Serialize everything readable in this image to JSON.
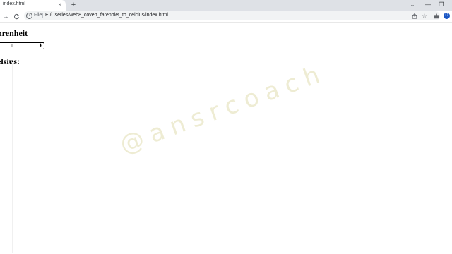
{
  "browser": {
    "tab_title": "index.html",
    "tab_close": "×",
    "new_tab": "+",
    "window_controls": {
      "minimize": "—",
      "maximize": "❐",
      "dropdown": "⌄"
    },
    "nav": {
      "forward": "→",
      "reload": "C"
    },
    "address": {
      "scheme_label": "File",
      "url": "E:/Cseries/web8_covert_farenhiet_to_celcius/index.html"
    },
    "toolbar_icons": {
      "share": "share-icon",
      "bookmark": "star-icon",
      "extensions": "puzzle-icon"
    },
    "profile_initial": "D"
  },
  "page": {
    "fahrenheit_heading": "hrenheit",
    "celsius_heading": "elsius:",
    "select_value": "",
    "watermark": "@ansrcoach"
  }
}
